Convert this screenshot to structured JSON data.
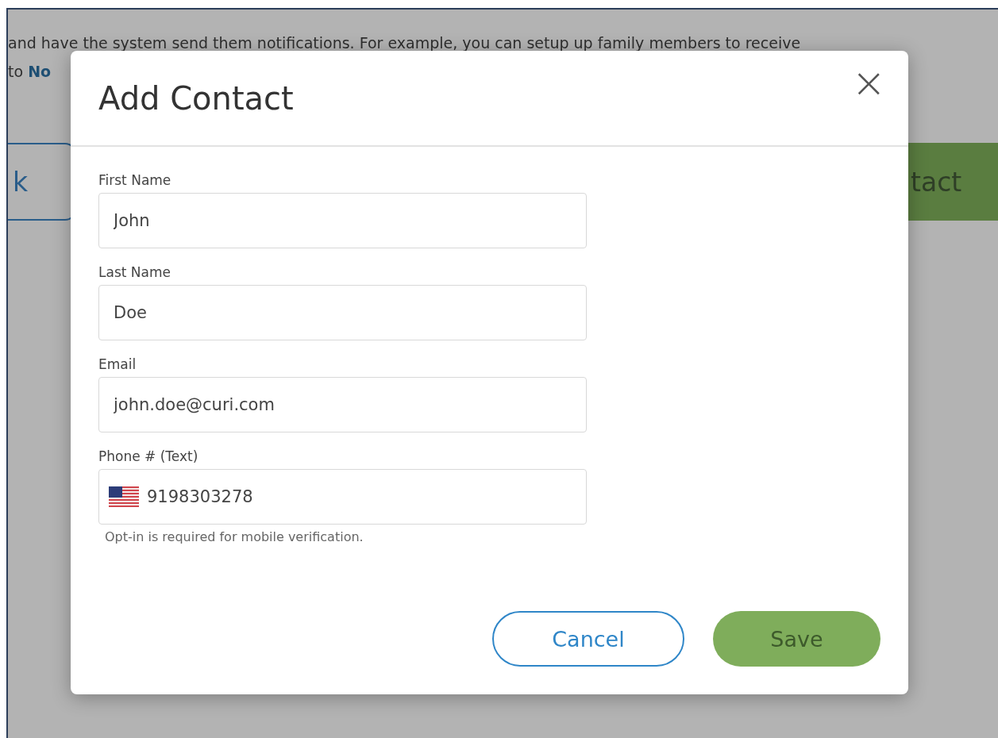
{
  "background": {
    "lines": [
      "and have the system send them notifications. For example, you can setup up family members to receive",
      "to **No**"
    ],
    "buttons": [
      {
        "label": "k",
        "kind": "outline"
      },
      {
        "label": "tact",
        "kind": "filled"
      }
    ]
  },
  "dialog": {
    "title": "Add Contact",
    "close": "×",
    "fields": [
      {
        "label": "First Name",
        "value": "John",
        "kind": "text"
      },
      {
        "label": "Last Name",
        "value": "Doe",
        "kind": "text"
      },
      {
        "label": "Email",
        "value": "john.doe@curi.com",
        "kind": "text"
      },
      {
        "label": "Phone # (Text)",
        "value": "9198303278",
        "kind": "phone",
        "hint": "Opt-in is required for mobile verification."
      }
    ],
    "buttons": [
      {
        "label": "Cancel",
        "kind": "outline"
      },
      {
        "label": "Save",
        "kind": "filled"
      }
    ]
  }
}
